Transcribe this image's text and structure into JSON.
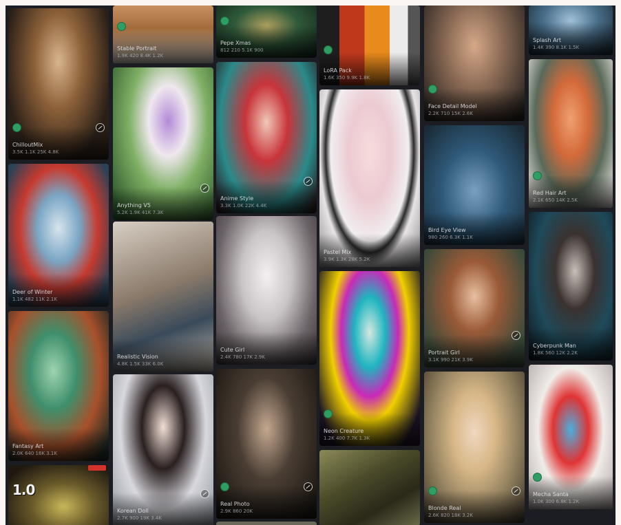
{
  "cards": [
    {
      "id": "c0",
      "title": "ChilloutMix",
      "stats": "3.5K 1.1K 25K 4.8K",
      "color": "#6b4a2c"
    },
    {
      "id": "c1",
      "title": "Deer of Winter",
      "stats": "1.1K 482 11K 2.1K",
      "color": "#3a6a85"
    },
    {
      "id": "c2",
      "title": "Fantasy Art",
      "stats": "2.0K 640 16K 3.1K",
      "color": "#2d6c54"
    },
    {
      "id": "c3",
      "banner": "1.0",
      "title": "",
      "stats": "",
      "color": "#3a2a1c"
    },
    {
      "id": "c4",
      "title": "Stable Portrait",
      "stats": "1.9K 420 8.4K 1.2K",
      "color": "#c89060"
    },
    {
      "id": "c5",
      "title": "Anything V5",
      "stats": "5.2K 1.9K 41K 7.3K",
      "color": "#5f8a55"
    },
    {
      "id": "c6",
      "title": "Realistic Vision",
      "stats": "4.8K 1.5K 33K 6.0K",
      "color": "#8a7a6a"
    },
    {
      "id": "c7",
      "title": "Korean Doll",
      "stats": "2.7K 900 19K 3.4K",
      "color": "#cfd0d6"
    },
    {
      "id": "c8",
      "title": "Pepe Xmas",
      "stats": "812 210 5.1K 900",
      "color": "#3a5a3a"
    },
    {
      "id": "c9",
      "title": "Anime Style",
      "stats": "3.3K 1.0K 22K 4.4K",
      "color": "#b0343a"
    },
    {
      "id": "c10",
      "title": "Cute Girl",
      "stats": "2.4K 780 17K 2.9K",
      "color": "#c7c3c4"
    },
    {
      "id": "c11",
      "title": "Real Photo",
      "stats": "2.9K 860 20K",
      "color": "#4a3e34"
    },
    {
      "id": "c12",
      "title": "",
      "stats": "",
      "color": "#6b6a5a"
    },
    {
      "id": "c13",
      "title": "LoRA Pack",
      "stats": "1.6K 350 9.9K 1.8K",
      "color": "#c04020"
    },
    {
      "id": "c14",
      "title": "Pastel Mix",
      "stats": "3.9K 1.3K 28K 5.2K",
      "color": "#e8dee0"
    },
    {
      "id": "c15",
      "title": "Neon Creature",
      "stats": "1.2K 400 7.7K 1.3K",
      "color": "#15a9b8"
    },
    {
      "id": "c16",
      "title": "",
      "stats": "",
      "color": "#5f5a3a"
    },
    {
      "id": "c17",
      "title": "Face Detail Model",
      "stats": "2.2K 710 15K 2.6K",
      "color": "#8a6a55"
    },
    {
      "id": "c18",
      "title": "Bird Eye View",
      "stats": "980 260 6.3K 1.1K",
      "color": "#3a5a7a"
    },
    {
      "id": "c19",
      "title": "Portrait Girl",
      "stats": "3.1K 990 21K 3.9K",
      "color": "#8a5a3c"
    },
    {
      "id": "c20",
      "title": "Blonde Real",
      "stats": "2.6K 820 18K 3.2K",
      "color": "#d8b888"
    },
    {
      "id": "c21",
      "title": "Splash Art",
      "stats": "1.4K 390 8.1K 1.5K",
      "color": "#4a6f8a"
    },
    {
      "id": "c22",
      "title": "Red Hair Art",
      "stats": "2.1K 650 14K 2.5K",
      "color": "#d46a3a"
    },
    {
      "id": "c23",
      "title": "Cyberpunk Man",
      "stats": "1.8K 560 12K 2.2K",
      "color": "#1f4a5a"
    },
    {
      "id": "c24",
      "title": "Mecha Santa",
      "stats": "1.0K 300 6.8K 1.2K",
      "color": "#e03434"
    }
  ]
}
